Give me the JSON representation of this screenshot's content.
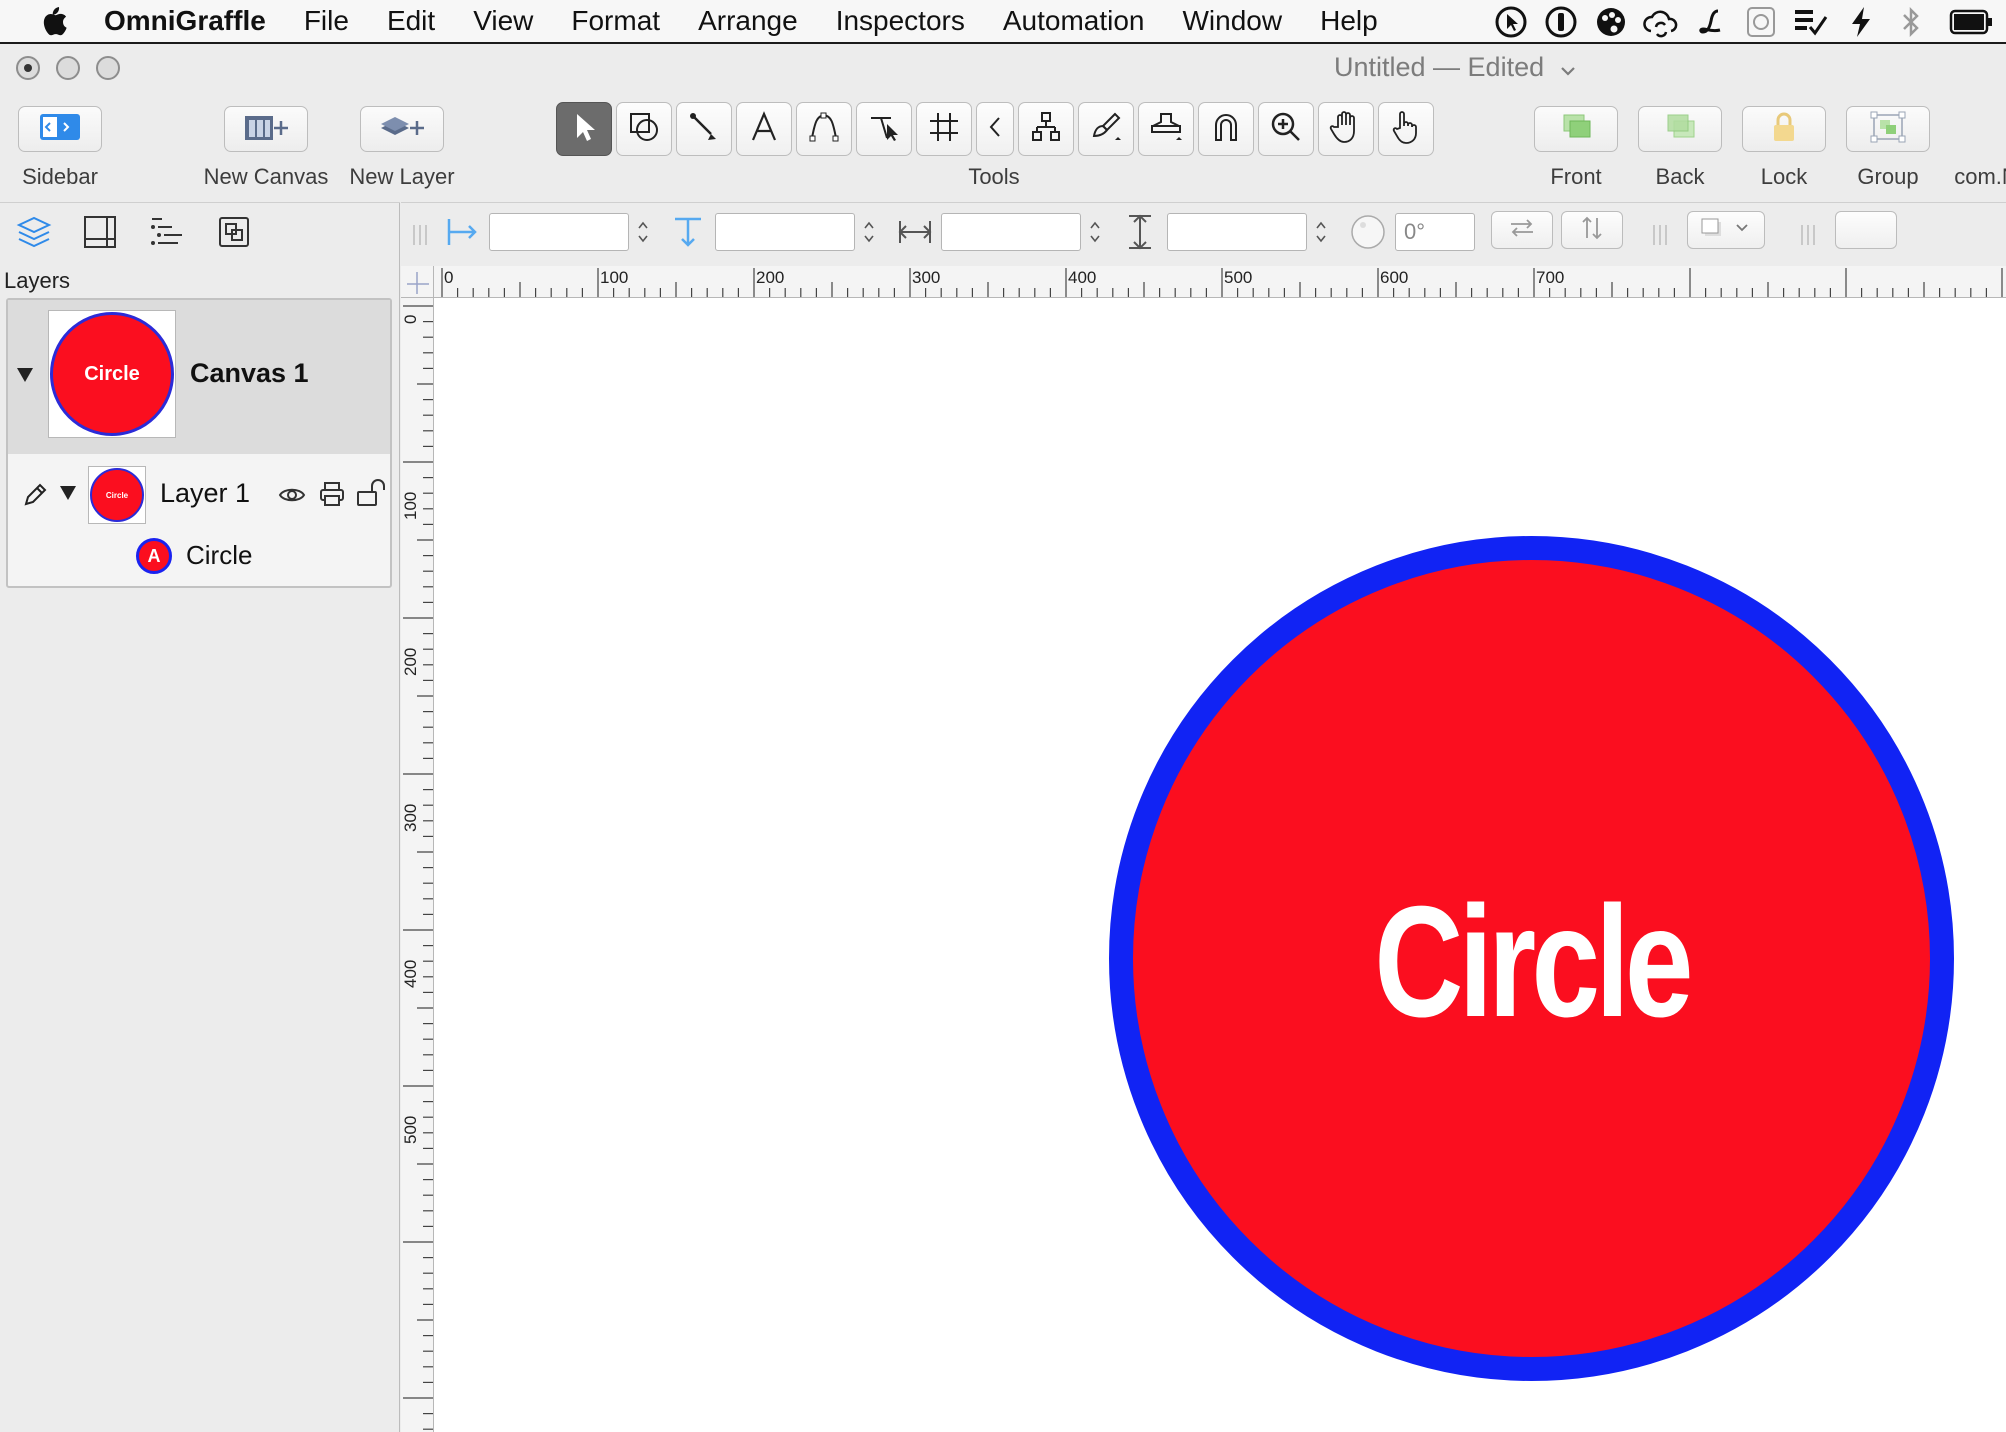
{
  "menubar": {
    "app_name": "OmniGraffle",
    "items": [
      "File",
      "Edit",
      "View",
      "Format",
      "Arrange",
      "Inspectors",
      "Automation",
      "Window",
      "Help"
    ],
    "extras_icons": [
      "cursor-status-icon",
      "info-status-icon",
      "palette-status-icon",
      "cloud-sync-icon",
      "script-l-icon",
      "copyright-box-icon",
      "task-check-icon",
      "lightning-icon",
      "bluetooth-icon",
      "battery-icon"
    ]
  },
  "window": {
    "title": "Untitled — Edited"
  },
  "toolbar": {
    "sidebar_label": "Sidebar",
    "new_canvas_label": "New Canvas",
    "new_layer_label": "New Layer",
    "tools_label": "Tools",
    "front_label": "Front",
    "back_label": "Back",
    "lock_label": "Lock",
    "group_label": "Group",
    "overflow_label": "com.N",
    "tools": [
      "selection-tool",
      "shape-tool",
      "line-tool",
      "text-tool",
      "pen-tool",
      "point-editor-tool",
      "table-tool",
      "collapse-tools",
      "diagram-tool",
      "style-brush-tool",
      "rubber-stamp-tool",
      "magnet-tool",
      "zoom-tool",
      "hand-tool",
      "browse-tool"
    ]
  },
  "sidebar": {
    "section_title": "Layers",
    "canvas_name": "Canvas 1",
    "canvas_thumb_label": "Circle",
    "layer_name": "Layer 1",
    "layer_thumb_label": "Circle",
    "object_badge": "A",
    "object_name": "Circle"
  },
  "inspector": {
    "x_value": "",
    "y_value": "",
    "width_value": "",
    "height_value": "",
    "rotation_value": "0°"
  },
  "rulers": {
    "horizontal_labels": [
      "0",
      "100",
      "200",
      "300",
      "400",
      "500",
      "600",
      "700"
    ],
    "vertical_labels": [
      "0",
      "100",
      "200",
      "300",
      "400",
      "500"
    ]
  },
  "canvas": {
    "shape_label": "Circle",
    "fill_color": "#fb0e1f",
    "stroke_color": "#1123f4"
  }
}
